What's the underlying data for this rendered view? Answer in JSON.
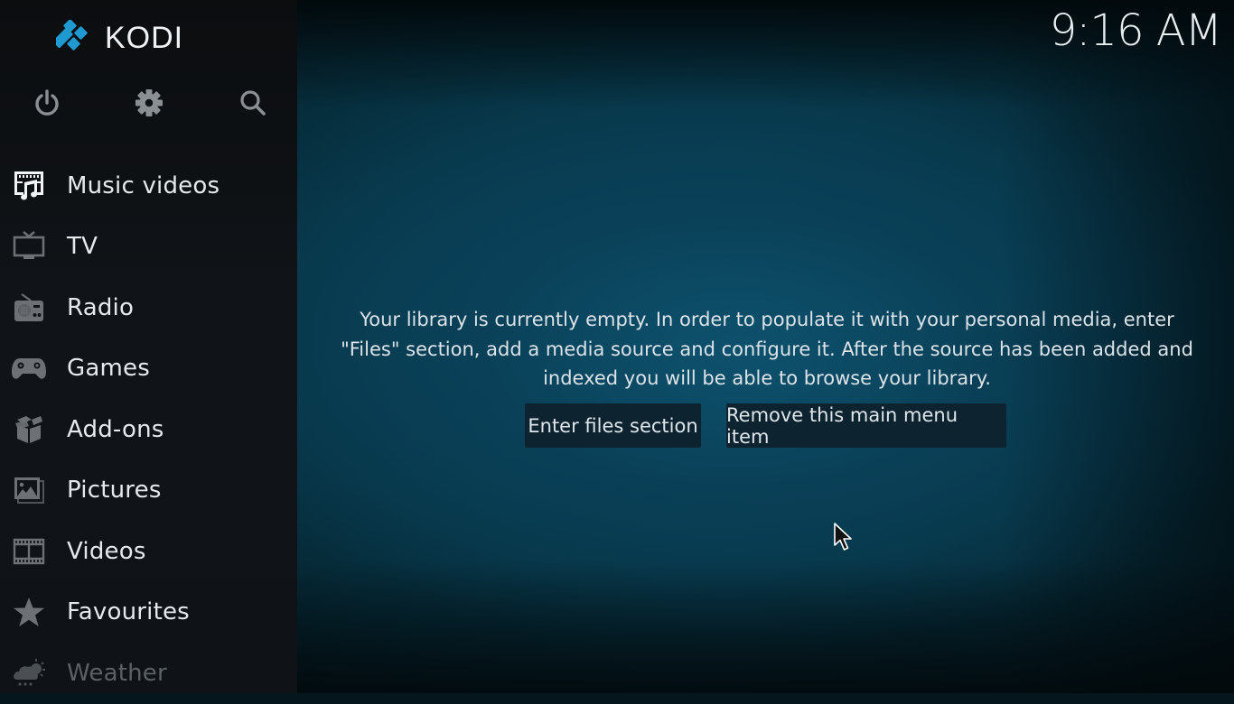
{
  "app": {
    "name": "KODI",
    "brand_color": "#1f9ad0"
  },
  "header": {
    "clock": "9:16 AM"
  },
  "top_buttons": [
    {
      "id": "power",
      "icon": "power-icon"
    },
    {
      "id": "settings",
      "icon": "gear-icon"
    },
    {
      "id": "search",
      "icon": "search-icon"
    }
  ],
  "sidebar": {
    "items": [
      {
        "label": "Music videos",
        "icon": "music-video-icon",
        "focused": true
      },
      {
        "label": "TV",
        "icon": "tv-icon"
      },
      {
        "label": "Radio",
        "icon": "radio-icon"
      },
      {
        "label": "Games",
        "icon": "gamepad-icon"
      },
      {
        "label": "Add-ons",
        "icon": "addons-box-icon"
      },
      {
        "label": "Pictures",
        "icon": "pictures-icon"
      },
      {
        "label": "Videos",
        "icon": "film-icon"
      },
      {
        "label": "Favourites",
        "icon": "star-icon"
      },
      {
        "label": "Weather",
        "icon": "weather-icon"
      }
    ]
  },
  "main": {
    "message": "Your library is currently empty. In order to populate it with your personal media, enter \"Files\" section, add a media source and configure it. After the source has been added and indexed you will be able to browse your library.",
    "buttons": {
      "enter_files": "Enter files section",
      "remove_item": "Remove this main menu item"
    }
  },
  "colors": {
    "icon_focused": "#f2f4f6",
    "icon_normal": "#6d7175",
    "text": "#e6e9ec",
    "button_bg": "#0d2330"
  }
}
